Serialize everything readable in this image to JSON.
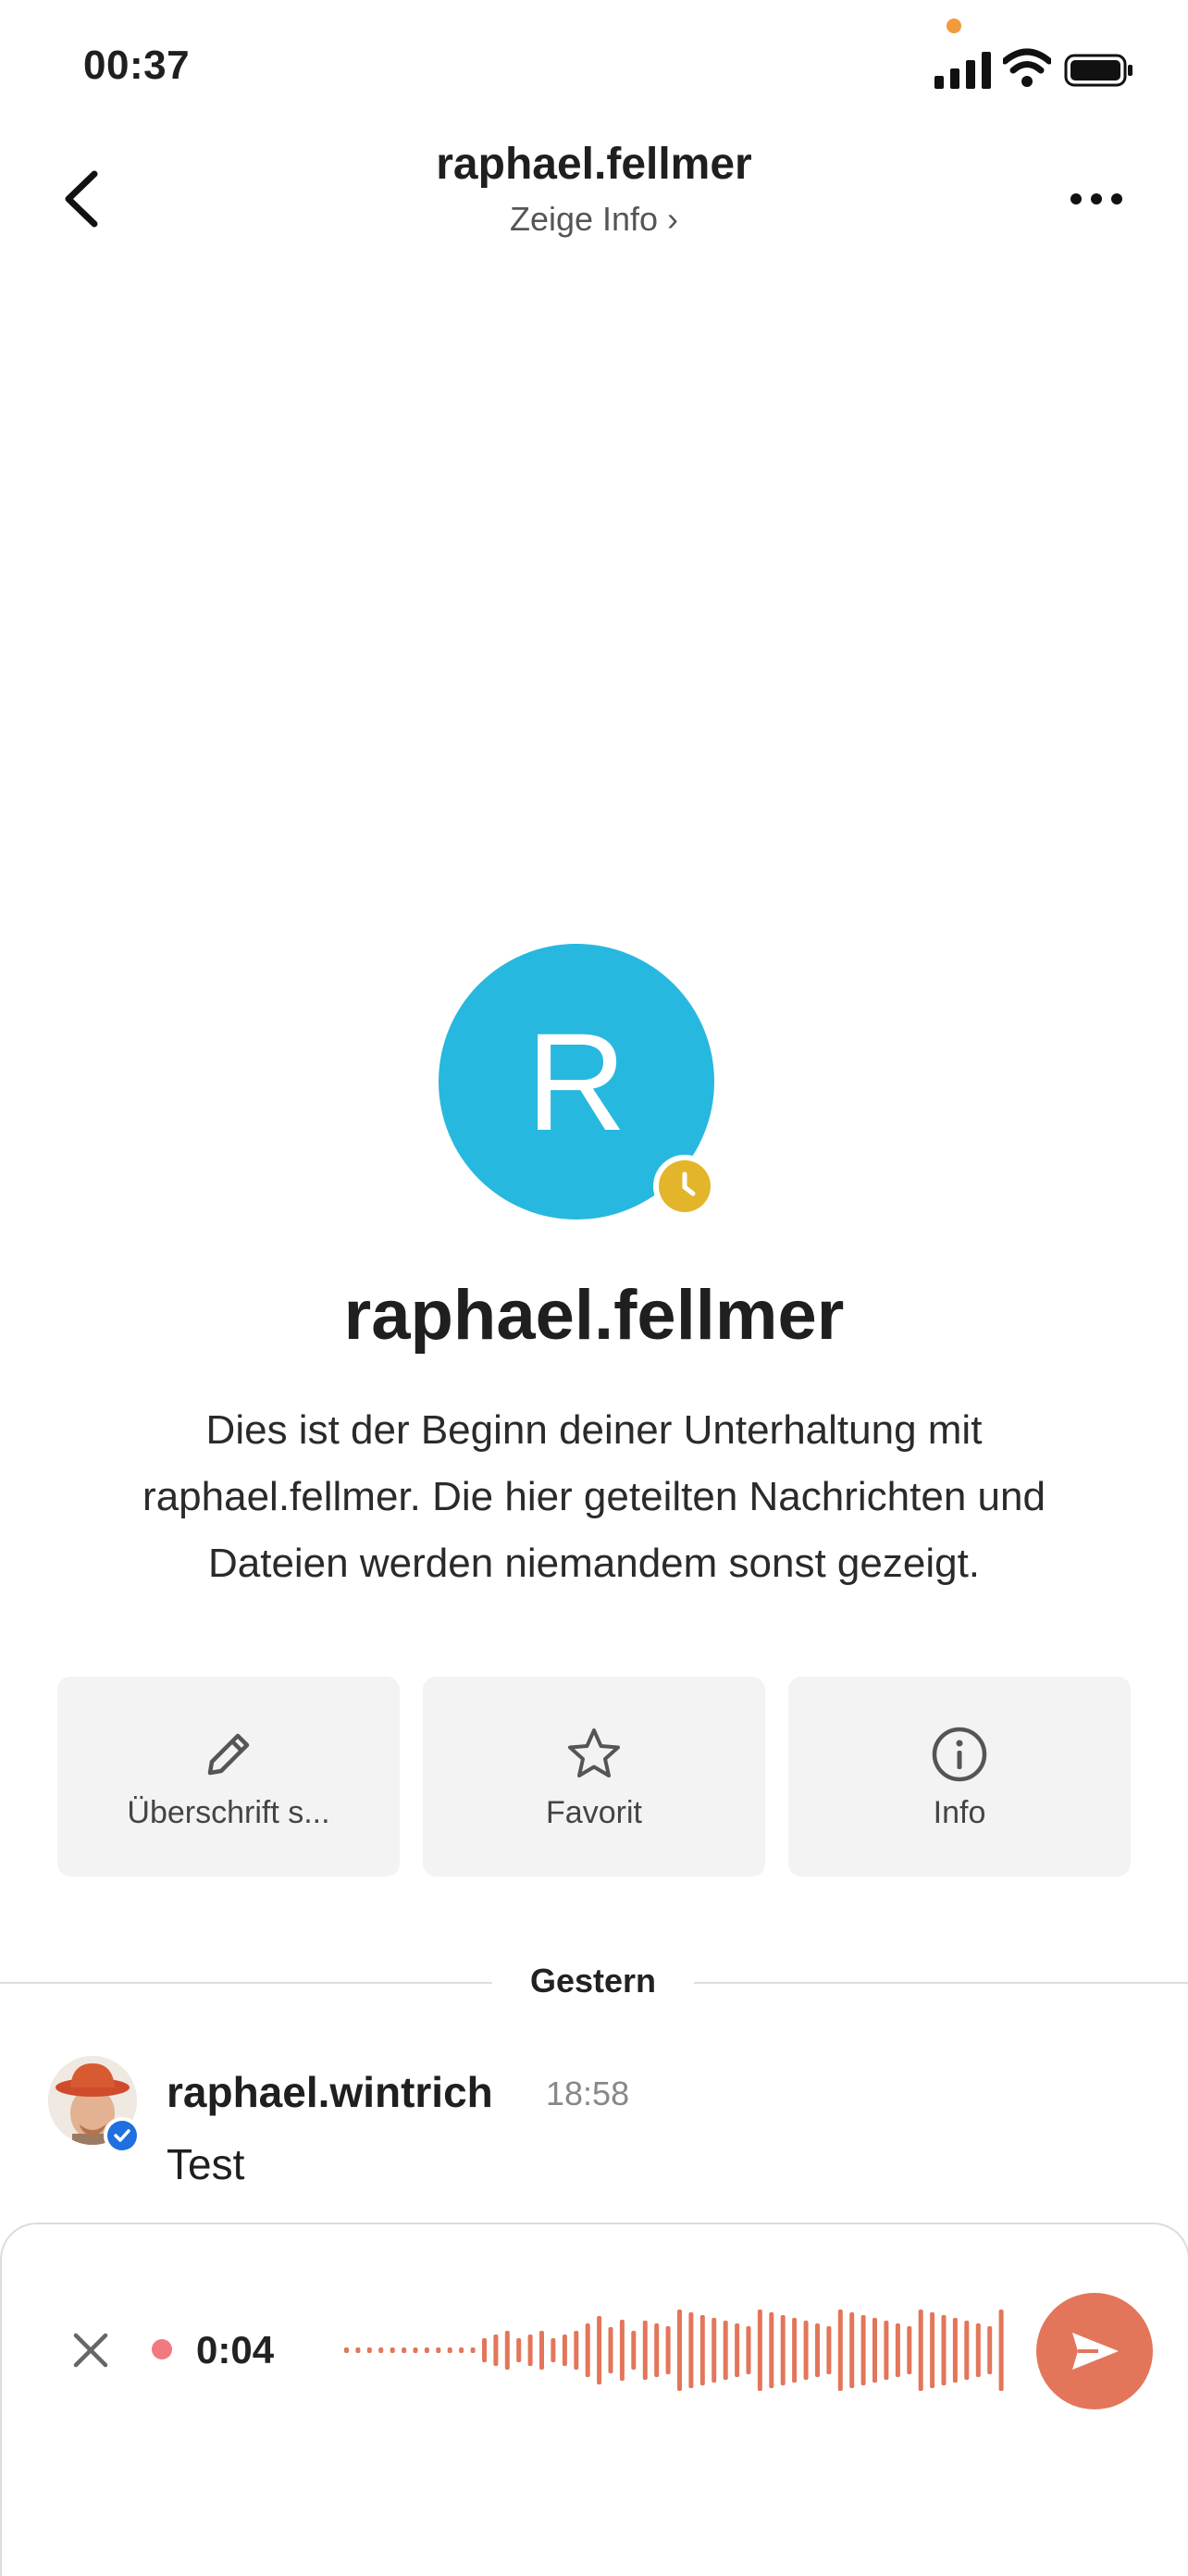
{
  "status_bar": {
    "time": "00:37"
  },
  "header": {
    "title": "raphael.fellmer",
    "subtitle": "Zeige Info ›"
  },
  "profile": {
    "avatar_letter": "R",
    "avatar_color": "#27b8df",
    "status_color": "#e3b52b",
    "name": "raphael.fellmer",
    "intro": "Dies ist der Beginn deiner Unterhaltung mit raphael.fellmer. Die hier geteilten Nachrichten und Dateien werden niemandem sonst gezeigt."
  },
  "actions": [
    {
      "label": "Überschrift s...",
      "icon": "pencil-icon"
    },
    {
      "label": "Favorit",
      "icon": "star-icon"
    },
    {
      "label": "Info",
      "icon": "info-icon"
    }
  ],
  "date_divider": "Gestern",
  "message": {
    "author": "raphael.wintrich",
    "time": "18:58",
    "text": "Test"
  },
  "composer": {
    "recording_time": "0:04",
    "accent_color": "#e3765a"
  }
}
